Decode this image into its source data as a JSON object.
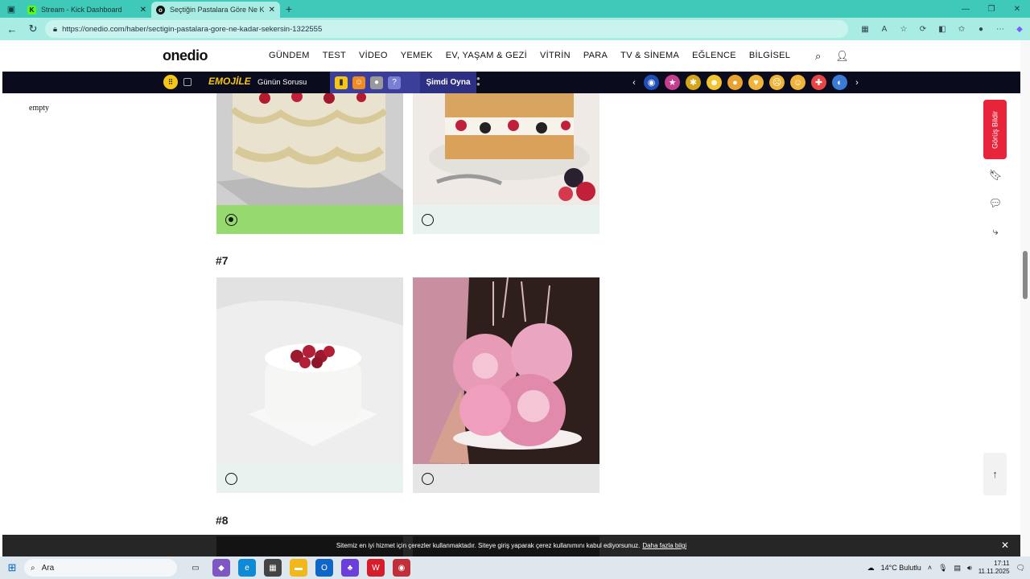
{
  "browser": {
    "tabs": [
      {
        "title": "Stream - Kick Dashboard",
        "favicon": "K"
      },
      {
        "title": "Seçtiğin Pastalara Göre Ne Kadar",
        "favicon": "o"
      }
    ],
    "url": "https://onedio.com/haber/sectigin-pastalara-gore-ne-kadar-sekersin-1322555"
  },
  "site": {
    "logo": "onedio",
    "menu": [
      "GÜNDEM",
      "TEST",
      "VİDEO",
      "YEMEK",
      "EV, YAŞAM & GEZİ",
      "VİTRİN",
      "PARA",
      "TV & SİNEMA",
      "EĞLENCE",
      "BİLGİSEL"
    ],
    "strip": {
      "emojile": "EMOJİLE",
      "gunun_sorusu": "Günün Sorusu",
      "simdi_oyna": "Şimdi Oyna"
    },
    "empty_text": "empty",
    "questions": [
      {
        "number": "#7"
      },
      {
        "number": "#8"
      }
    ],
    "side": {
      "gorus": "Görüş Bildir"
    },
    "cookie": {
      "text": "Sitemiz en iyi hizmet için çerezler kullanmaktadır. Siteye giriş yaparak çerez kullanımını kabul ediyorsunuz.",
      "link": "Daha fazla bilgi"
    }
  },
  "taskbar": {
    "search": "Ara",
    "weather": "14°C  Bulutlu",
    "time": "17:11",
    "date": "11.11.2025"
  },
  "colors": {
    "selected": "#96d96f",
    "option_bg": "#e8f3ef",
    "accent": "#3ec9b8"
  }
}
